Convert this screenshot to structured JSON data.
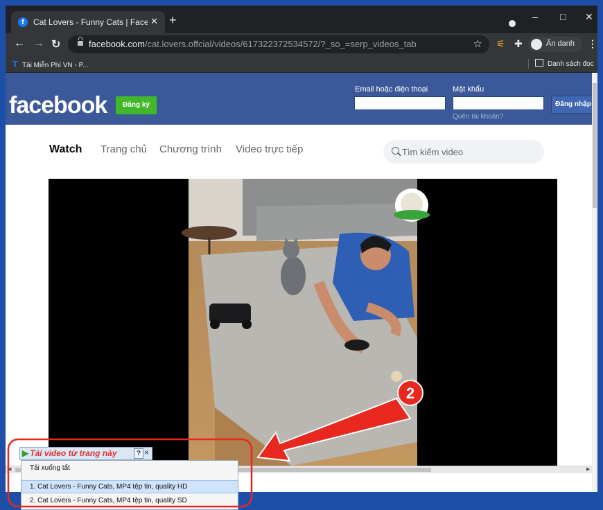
{
  "browser": {
    "tab_title": "Cat Lovers - Funny Cats | Facebo",
    "tab_favicon": "facebook-favicon-icon",
    "url_domain": "facebook.com",
    "url_path": "/cat.lovers.offcial/videos/617322372534572/?_so_=serp_videos_tab",
    "incognito_label": "Ẩn danh",
    "bookmark_item": "Tải Miễn Phí VN - P...",
    "reading_list": "Danh sách đọc"
  },
  "facebook": {
    "logo": "facebook",
    "signup_label": "Đăng ký",
    "email_label": "Email hoặc điện thoại",
    "password_label": "Mật khẩu",
    "forgot_label": "Quên tài khoản?",
    "login_label": "Đăng nhập",
    "brand_color": "#3b5998"
  },
  "watch_nav": {
    "items": [
      "Watch",
      "Trang chủ",
      "Chương trình",
      "Video trực tiếp"
    ],
    "search_placeholder": "Tìm kiếm video"
  },
  "download_popup": {
    "title": "Tải video từ trang này",
    "help": "?",
    "close": "×",
    "items": [
      "Tải xuống tất",
      "1. Cat Lovers - Funny Cats,  MP4 tệp tin, quality HD",
      "2. Cat Lovers - Funny Cats,  MP4 tệp tin, quality SD"
    ]
  },
  "annotation": {
    "step_number": "2",
    "color": "#e8271f"
  }
}
